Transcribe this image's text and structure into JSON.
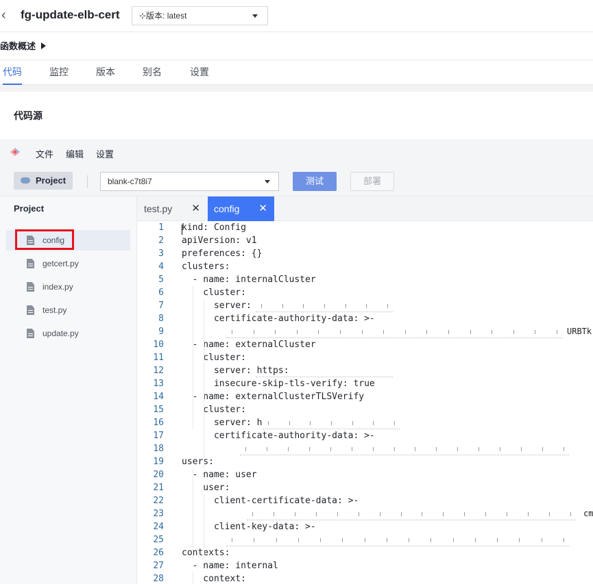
{
  "header": {
    "back_icon": "chevron-left-icon",
    "function_name": "fg-update-elb-cert",
    "version_label": "⊹版本: latest"
  },
  "overview": {
    "label": "函数概述"
  },
  "tabs": [
    {
      "label": "代码",
      "active": true
    },
    {
      "label": "监控"
    },
    {
      "label": "版本"
    },
    {
      "label": "别名"
    },
    {
      "label": "设置"
    }
  ],
  "section_title": "代码源",
  "menu": {
    "file": "文件",
    "edit": "编辑",
    "settings": "设置"
  },
  "toolbar": {
    "project_label": "Project",
    "branch_value": "blank-c7t8i7",
    "test_label": "测试",
    "deploy_label": "部署"
  },
  "sidebar": {
    "title": "Project",
    "files": [
      {
        "name": "config",
        "selected": true
      },
      {
        "name": "getcert.py"
      },
      {
        "name": "index.py"
      },
      {
        "name": "test.py"
      },
      {
        "name": "update.py"
      }
    ]
  },
  "editor": {
    "tabs": [
      {
        "label": "test.py",
        "active": false
      },
      {
        "label": "config",
        "active": true
      }
    ],
    "lines": [
      {
        "n": "1",
        "text": "kind: Config"
      },
      {
        "n": "2",
        "text": "apiVersion: v1"
      },
      {
        "n": "3",
        "text": "preferences: {}"
      },
      {
        "n": "4",
        "text": "clusters:"
      },
      {
        "n": "5",
        "text": "  - name: internalCluster"
      },
      {
        "n": "6",
        "text": "    cluster:"
      },
      {
        "n": "7",
        "text": "      server: "
      },
      {
        "n": "8",
        "text": "      certificate-authority-data: >-"
      },
      {
        "n": "9",
        "text": ""
      },
      {
        "n": "10",
        "text": "  - name: externalCluster"
      },
      {
        "n": "11",
        "text": "    cluster:"
      },
      {
        "n": "12",
        "text": "      server: https:"
      },
      {
        "n": "13",
        "text": "      insecure-skip-tls-verify: true"
      },
      {
        "n": "14",
        "text": "  - name: externalClusterTLSVerify"
      },
      {
        "n": "15",
        "text": "    cluster:"
      },
      {
        "n": "16",
        "text": "      server: h"
      },
      {
        "n": "17",
        "text": "      certificate-authority-data: >-"
      },
      {
        "n": "18",
        "text": ""
      },
      {
        "n": "19",
        "text": "users:"
      },
      {
        "n": "20",
        "text": "  - name: user"
      },
      {
        "n": "21",
        "text": "    user:"
      },
      {
        "n": "22",
        "text": "      client-certificate-data: >-"
      },
      {
        "n": "23",
        "text": ""
      },
      {
        "n": "24",
        "text": "      client-key-data: >-"
      },
      {
        "n": "25",
        "text": ""
      },
      {
        "n": "26",
        "text": "contexts:"
      },
      {
        "n": "27",
        "text": "  - name: internal"
      },
      {
        "n": "28",
        "text": "    context:"
      }
    ],
    "line9_tail": "URBTk",
    "line23_tail": "cm"
  },
  "colors": {
    "accent": "#3f76f5",
    "highlight": "#e8111b"
  }
}
